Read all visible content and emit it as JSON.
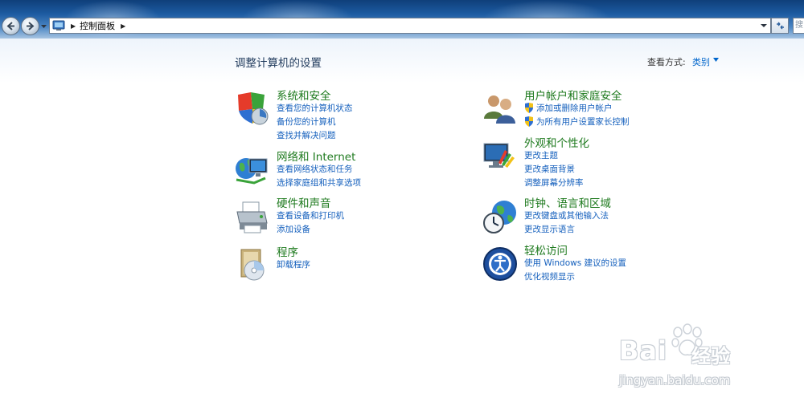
{
  "address_bar": {
    "breadcrumb": "控制面板",
    "search_placeholder": "搜"
  },
  "header": {
    "page_title": "调整计算机的设置",
    "view_by_label": "查看方式:",
    "view_by_value": "类别"
  },
  "categories": [
    {
      "title": "系统和安全",
      "icon": "shield-system-security-icon",
      "links": [
        "查看您的计算机状态",
        "备份您的计算机",
        "查找并解决问题"
      ]
    },
    {
      "title": "网络和 Internet",
      "icon": "network-globe-icon",
      "links": [
        "查看网络状态和任务",
        "选择家庭组和共享选项"
      ]
    },
    {
      "title": "硬件和声音",
      "icon": "printer-hardware-icon",
      "links": [
        "查看设备和打印机",
        "添加设备"
      ]
    },
    {
      "title": "程序",
      "icon": "programs-disc-icon",
      "links": [
        "卸载程序"
      ]
    },
    {
      "title": "用户帐户和家庭安全",
      "icon": "users-accounts-icon",
      "links": [
        "添加或删除用户帐户",
        "为所有用户设置家长控制"
      ],
      "links_shielded": true
    },
    {
      "title": "外观和个性化",
      "icon": "appearance-monitor-icon",
      "links": [
        "更改主题",
        "更改桌面背景",
        "调整屏幕分辨率"
      ]
    },
    {
      "title": "时钟、语言和区域",
      "icon": "clock-globe-icon",
      "links": [
        "更改键盘或其他输入法",
        "更改显示语言"
      ]
    },
    {
      "title": "轻松访问",
      "icon": "ease-of-access-icon",
      "links": [
        "使用 Windows 建议的设置",
        "优化视频显示"
      ]
    }
  ],
  "watermark": {
    "brand_left": "Bai",
    "brand_right": "经验",
    "url": "jingyan.baidu.com"
  },
  "colors": {
    "title_bar": "#1c5aa0",
    "category_title": "#1e7a1e",
    "link": "#1560bd",
    "page_title": "#1e395b"
  }
}
